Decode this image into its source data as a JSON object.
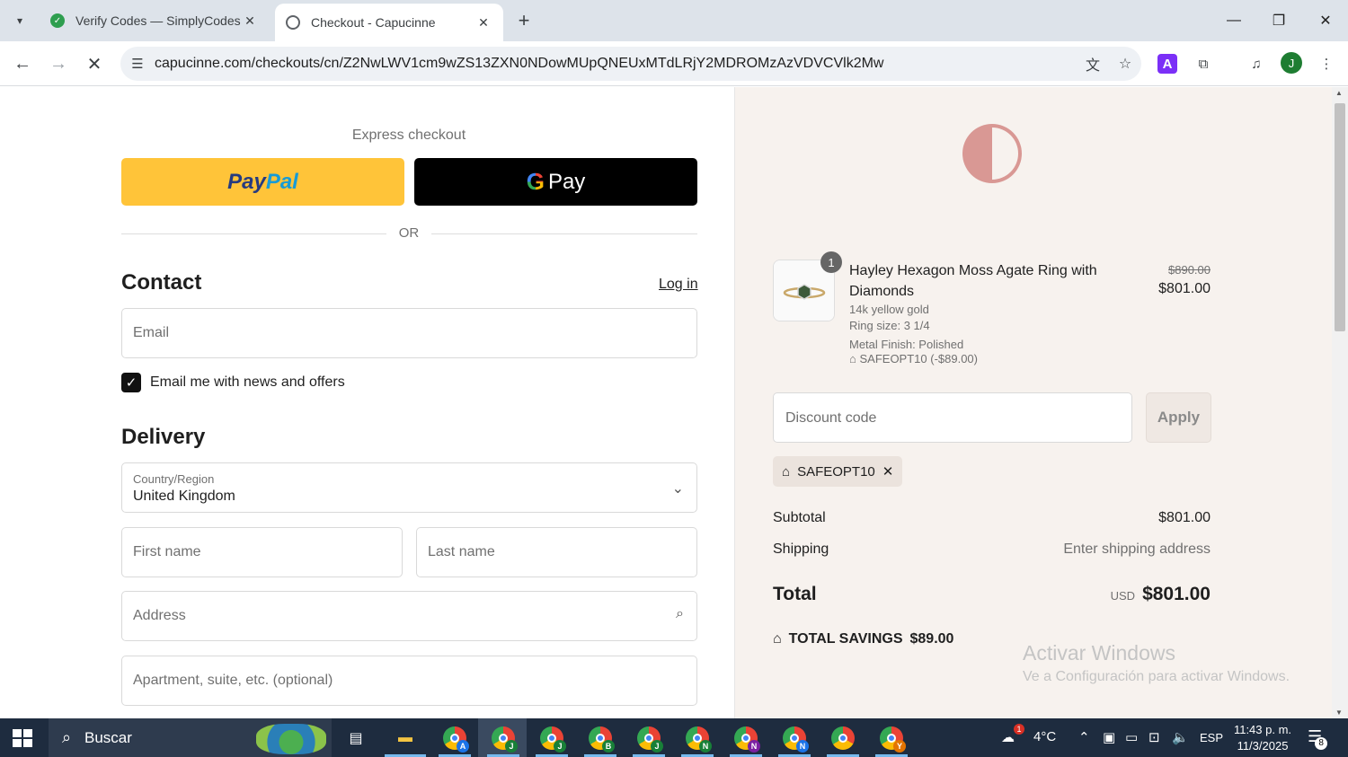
{
  "browser": {
    "tabs": [
      {
        "title": "Verify Codes — SimplyCodes",
        "active": false
      },
      {
        "title": "Checkout - Capucinne",
        "active": true
      }
    ],
    "url": "capucinne.com/checkouts/cn/Z2NwLWV1cm9wZS13ZXN0NDowMUpQNEUxMTdLRjY2MDROMzAzVDVCVlk2Mw",
    "profile_initial": "J"
  },
  "checkout": {
    "express_title": "Express checkout",
    "paypal_part1": "Pay",
    "paypal_part2": "Pal",
    "gpay_label": "Pay",
    "or_text": "OR",
    "contact_heading": "Contact",
    "login_link": "Log in",
    "email_placeholder": "Email",
    "newsletter_label": "Email me with news and offers",
    "newsletter_checked": true,
    "delivery_heading": "Delivery",
    "country_label": "Country/Region",
    "country_value": "United Kingdom",
    "first_name_placeholder": "First name",
    "last_name_placeholder": "Last name",
    "address_placeholder": "Address",
    "apartment_placeholder": "Apartment, suite, etc. (optional)"
  },
  "summary": {
    "item": {
      "quantity": "1",
      "name": "Hayley Hexagon Moss Agate Ring with Diamonds",
      "metal": "14k yellow gold",
      "ring_size": "Ring size: 3 1/4",
      "finish": "Metal Finish: Polished",
      "discount": "SAFEOPT10 (-$89.00)",
      "price_original": "$890.00",
      "price": "$801.00"
    },
    "discount_placeholder": "Discount code",
    "apply_label": "Apply",
    "applied_code": "SAFEOPT10",
    "subtotal_label": "Subtotal",
    "subtotal_value": "$801.00",
    "shipping_label": "Shipping",
    "shipping_value": "Enter shipping address",
    "total_label": "Total",
    "total_currency": "USD",
    "total_value": "$801.00",
    "savings_label": "TOTAL SAVINGS",
    "savings_value": "$89.00"
  },
  "watermark": {
    "line1": "Activar Windows",
    "line2": "Ve a Configuración para activar Windows."
  },
  "taskbar": {
    "search_placeholder": "Buscar",
    "weather": "4°C",
    "weather_badge": "1",
    "language": "ESP",
    "time": "11:43 p. m.",
    "date": "11/3/2025",
    "notifications": "8",
    "chrome_badges": [
      "A",
      "J",
      "J",
      "B",
      "J",
      "N",
      "N",
      "N",
      "",
      "Y"
    ]
  },
  "colors": {
    "paypal_yellow": "#ffc439",
    "summary_bg": "#f7f2ee",
    "logo": "#d99894",
    "taskbar": "#1e2c3f"
  }
}
